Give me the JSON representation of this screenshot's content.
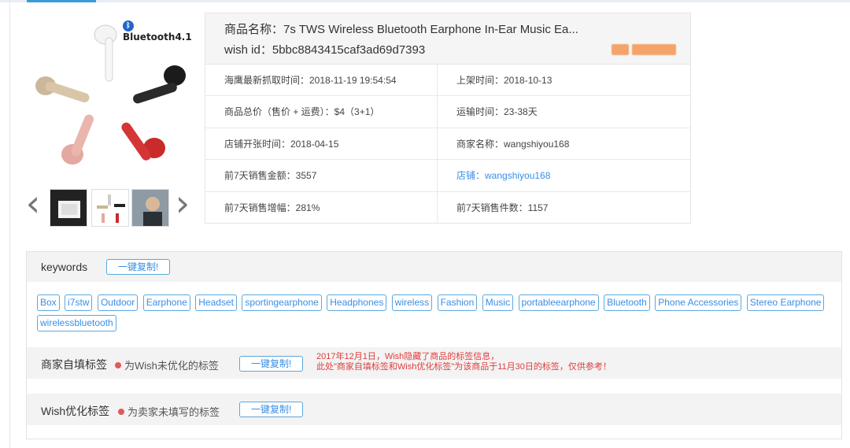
{
  "product": {
    "badge": "Bluetooth4.1",
    "name_line": "商品名称：7s TWS Wireless Bluetooth Earphone In-Ear Music Ea...",
    "wish_id_line": "wish id：5bbc8843415caf3ad69d7393"
  },
  "gallery": {
    "prev_icon": "chevron-left-icon",
    "next_icon": "chevron-right-icon"
  },
  "info": {
    "cells": [
      "海鹰最新抓取时间：2018-11-19 19:54:54",
      "上架时间：2018-10-13",
      "商品总价（售价 + 运费）：$4（3+1）",
      "运输时间：23-38天",
      "店铺开张时间：2018-04-15",
      "商家名称：wangshiyou168",
      "前7天销售金额：3557",
      "店铺：wangshiyou168",
      "前7天销售增幅：281%",
      "前7天销售件数：1157"
    ]
  },
  "keywords": {
    "title": "keywords",
    "copy_label": "一键复制!",
    "chips": [
      "Box",
      "i7stw",
      "Outdoor",
      "Earphone",
      "Headset",
      "sportingearphone",
      "Headphones",
      "wireless",
      "Fashion",
      "Music",
      "portableearphone",
      "Bluetooth",
      "Phone Accessories",
      "Stereo Earphone",
      "wirelessbluetooth"
    ]
  },
  "merchant_tags": {
    "title": "商家自填标签",
    "hint": "为Wish未优化的标签",
    "copy_label": "一键复制!",
    "notice_line1": "2017年12月1日，Wish隐藏了商品的标签信息，",
    "notice_line2": "此处\"商家自填标签和Wish优化标签\"为该商品于11月30日的标签，仅供参考！"
  },
  "wish_tags": {
    "title": "Wish优化标签",
    "hint": "为卖家未填写的标签",
    "copy_label": "一键复制!"
  },
  "colors": {
    "accent": "#3a8ee6",
    "warning": "#e03c3c"
  }
}
